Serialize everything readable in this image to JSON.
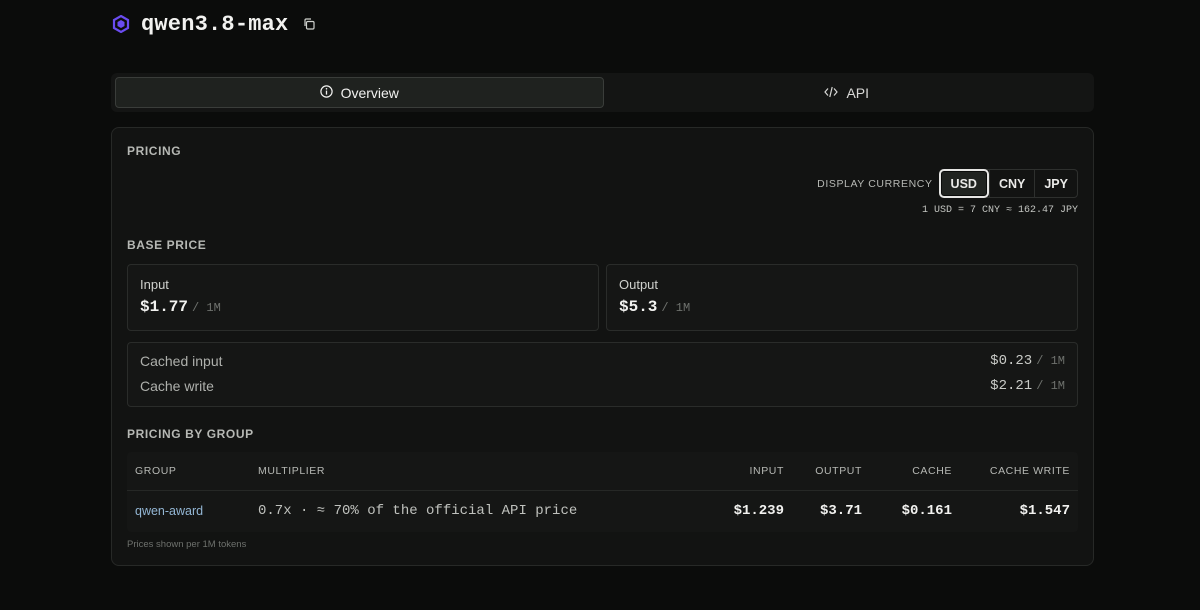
{
  "header": {
    "model_name": "qwen3.8-max",
    "logo_icon": "qwen-logo-icon",
    "copy_icon": "copy-icon",
    "brand_color": "#6a4cf0"
  },
  "tabs": [
    {
      "label": "Overview",
      "icon": "info-circle-icon",
      "active": true
    },
    {
      "label": "API",
      "icon": "code-icon",
      "active": false
    }
  ],
  "pricing": {
    "section_label": "PRICING",
    "currency": {
      "label": "DISPLAY CURRENCY",
      "options": [
        "USD",
        "CNY",
        "JPY"
      ],
      "selected": "USD",
      "rate_text": "1 USD = 7 CNY ≈ 162.47 JPY"
    },
    "base_price": {
      "section_label": "BASE PRICE",
      "input": {
        "label": "Input",
        "value": "$1.77",
        "unit": "/ 1M"
      },
      "output": {
        "label": "Output",
        "value": "$5.3",
        "unit": "/ 1M"
      }
    },
    "cache": [
      {
        "label": "Cached input",
        "value": "$0.23",
        "unit": "/ 1M"
      },
      {
        "label": "Cache write",
        "value": "$2.21",
        "unit": "/ 1M"
      }
    ],
    "by_group": {
      "section_label": "PRICING BY GROUP",
      "columns": [
        "GROUP",
        "MULTIPLIER",
        "INPUT",
        "OUTPUT",
        "CACHE",
        "CACHE WRITE"
      ],
      "rows": [
        {
          "group": "qwen-award",
          "multiplier": "0.7x · ≈ 70% of the official API price",
          "input": "$1.239",
          "output": "$3.71",
          "cache": "$0.161",
          "cache_write": "$1.547"
        }
      ],
      "footnote": "Prices shown per 1M tokens"
    }
  }
}
